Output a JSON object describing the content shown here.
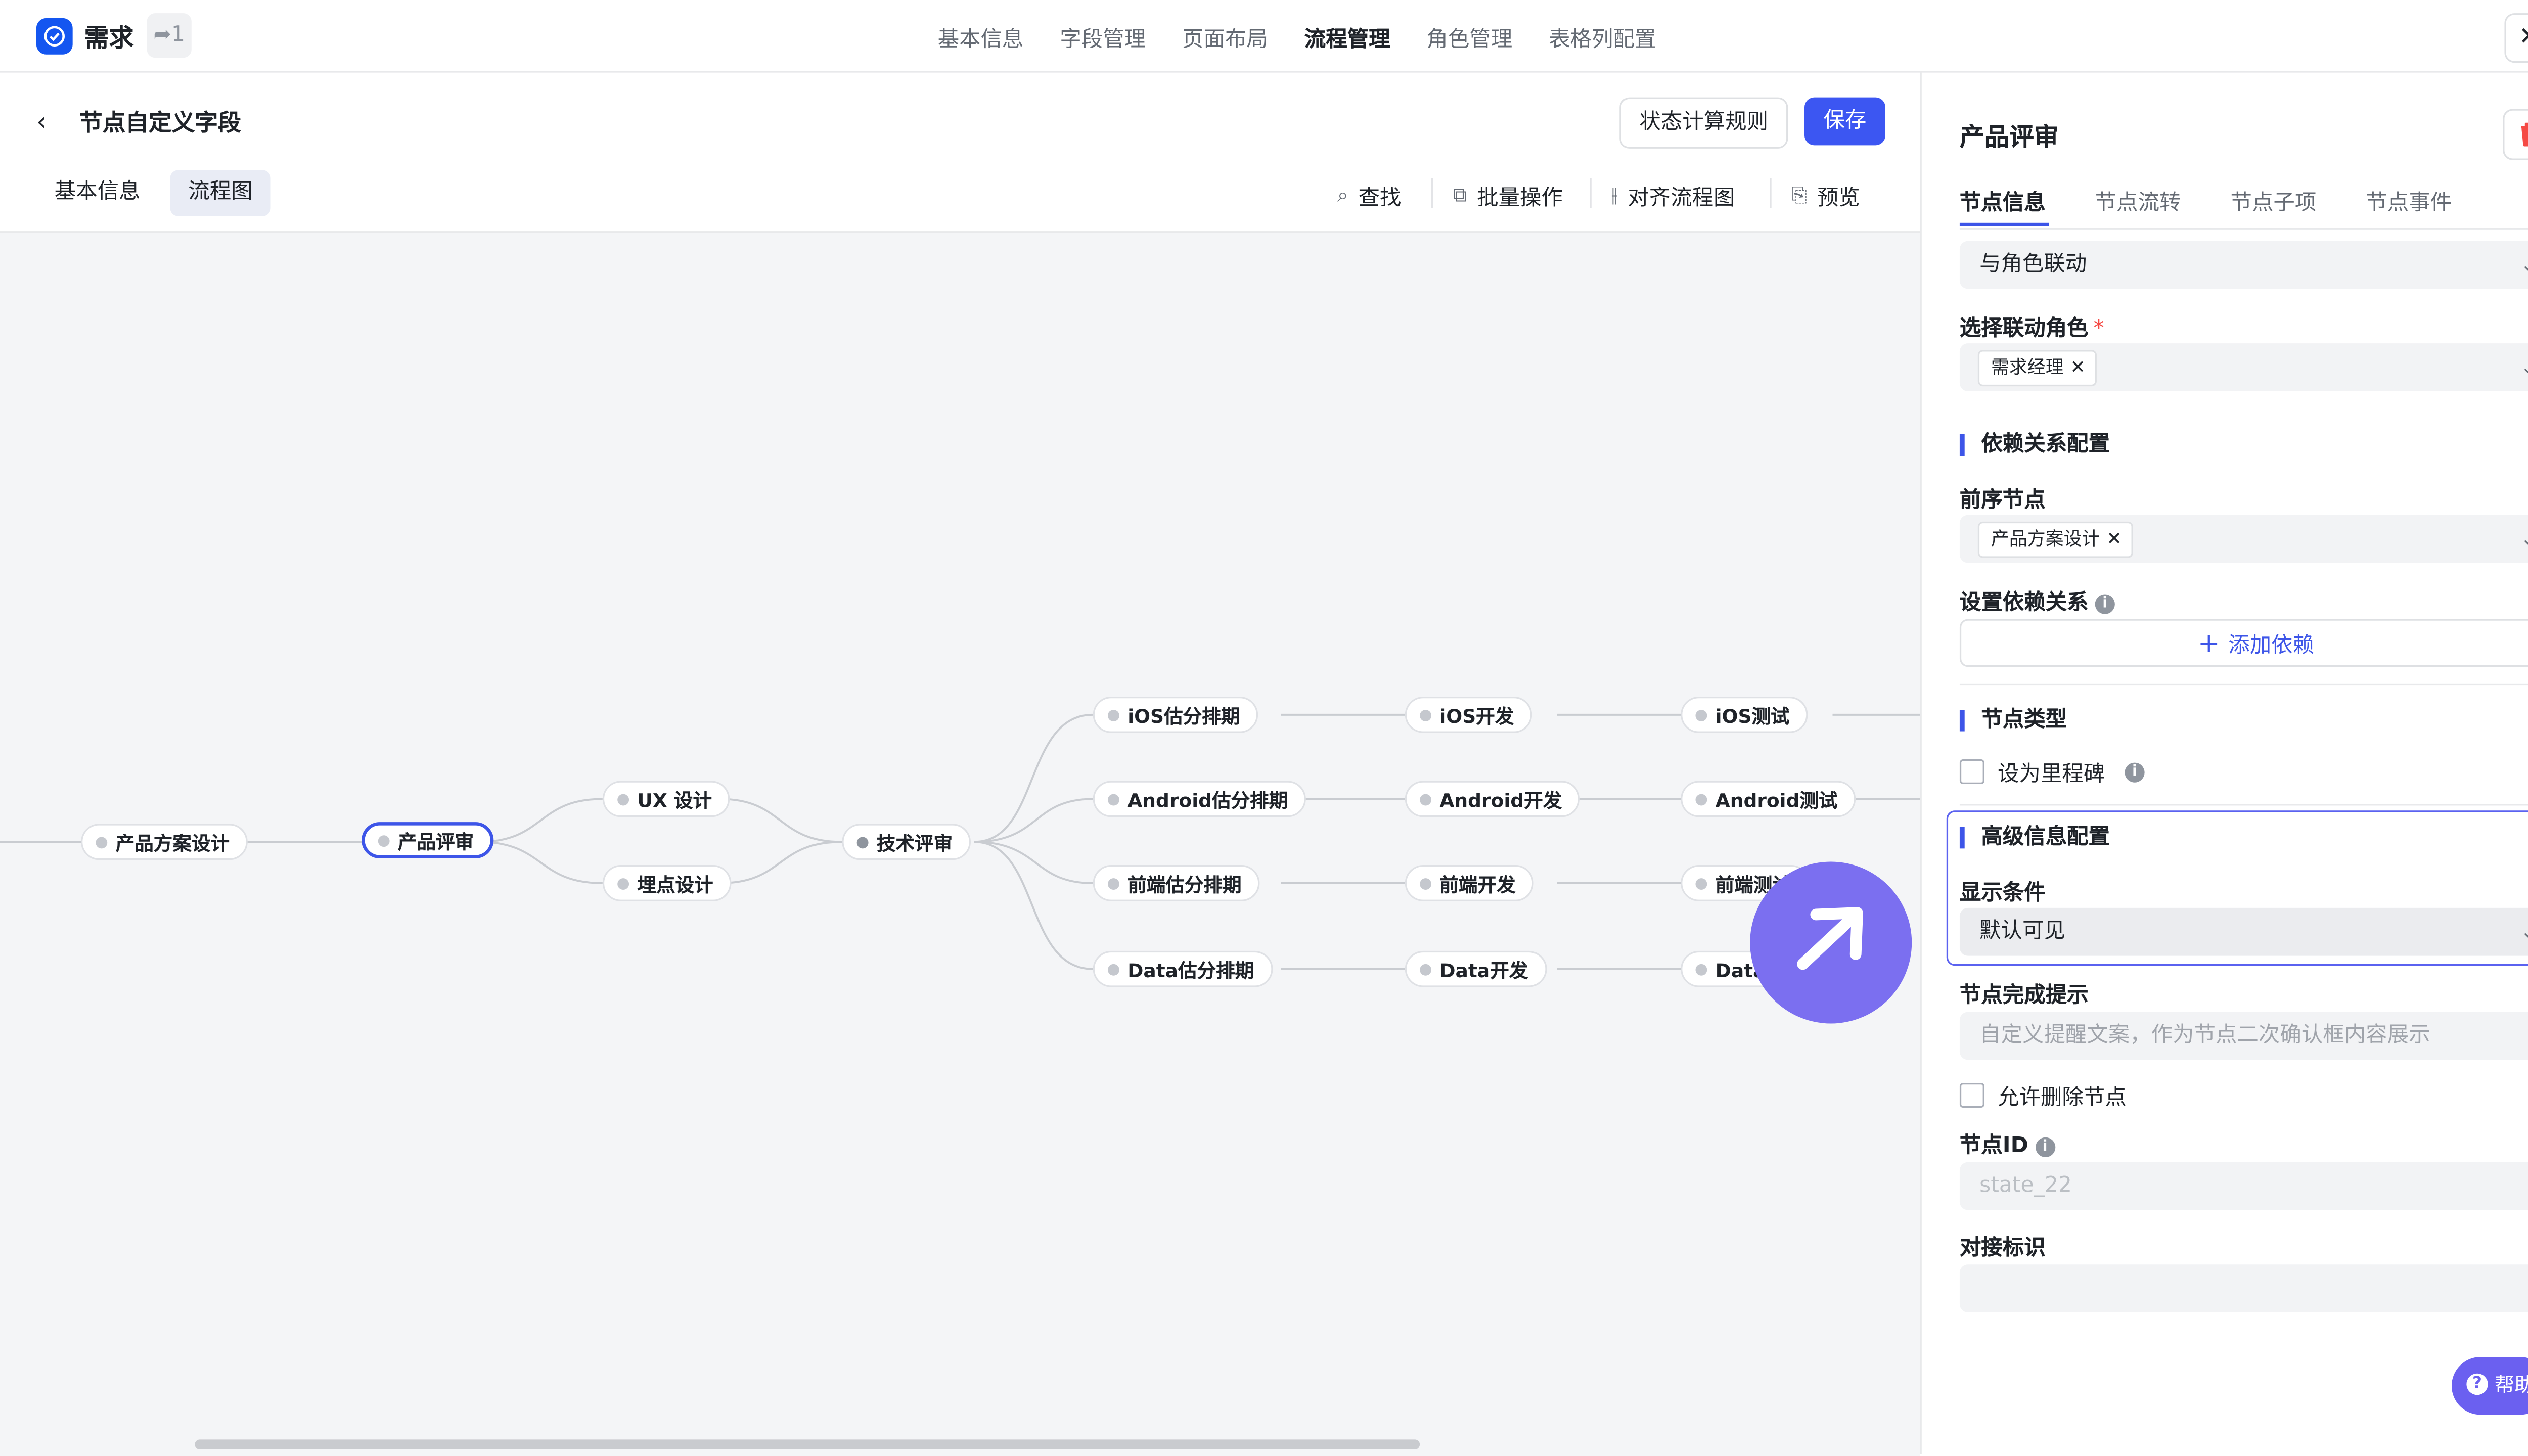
{
  "app": {
    "title": "需求",
    "share_count": "1"
  },
  "nav": [
    "基本信息",
    "字段管理",
    "页面布局",
    "流程管理",
    "角色管理",
    "表格列配置"
  ],
  "nav_active": "流程管理",
  "page": {
    "title": "节点自定义字段",
    "rule_button": "状态计算规则",
    "save_button": "保存"
  },
  "subtabs": [
    "基本信息",
    "流程图"
  ],
  "toolbar": {
    "find": "查找",
    "batch": "批量操作",
    "align": "对齐流程图",
    "preview": "预览"
  },
  "flow_nodes": {
    "product_design": "产品方案设计",
    "product_review": "产品评审",
    "ux_design": "UX 设计",
    "tracking_design": "埋点设计",
    "tech_review": "技术评审",
    "ios_schedule": "iOS估分排期",
    "android_schedule": "Android估分排期",
    "fe_schedule": "前端估分排期",
    "data_schedule": "Data估分排期",
    "ios_dev": "iOS开发",
    "android_dev": "Android开发",
    "fe_dev": "前端开发",
    "data_dev": "Data开发",
    "ios_test": "iOS测试",
    "android_test": "Android测试",
    "fe_test": "前端测试",
    "data_test": "Data测试"
  },
  "panel": {
    "title": "产品评审",
    "tabs": [
      "节点信息",
      "节点流转",
      "节点子项",
      "节点事件"
    ],
    "role_link_select": "与角色联动",
    "linked_role_label": "选择联动角色",
    "linked_role_tag": "需求经理",
    "dependency_section": "依赖关系配置",
    "predecessor_label": "前序节点",
    "predecessor_tag": "产品方案设计",
    "set_dependency_label": "设置依赖关系",
    "add_dependency": "添加依赖",
    "node_type_section": "节点类型",
    "milestone_checkbox": "设为里程碑",
    "advanced_section": "高级信息配置",
    "display_condition_label": "显示条件",
    "display_condition_value": "默认可见",
    "completion_tip_label": "节点完成提示",
    "completion_tip_placeholder": "自定义提醒文案，作为节点二次确认框内容展示",
    "allow_delete_checkbox": "允许删除节点",
    "node_id_label": "节点ID",
    "node_id_value": "state_22",
    "docking_label": "对接标识",
    "docking_value": ""
  },
  "help_button": "帮助",
  "colors": {
    "primary": "#3c56f2",
    "fab": "#7b6ff0",
    "help": "#6b60f0",
    "delete": "#f54a45"
  },
  "icons": [
    "app-check-icon",
    "share-icon",
    "close-icon",
    "back-arrow-icon",
    "search-icon",
    "batch-icon",
    "align-icon",
    "preview-icon",
    "trash-icon",
    "chevron-down-icon",
    "plus-icon",
    "info-icon",
    "arrow-up-right-icon",
    "help-icon"
  ]
}
